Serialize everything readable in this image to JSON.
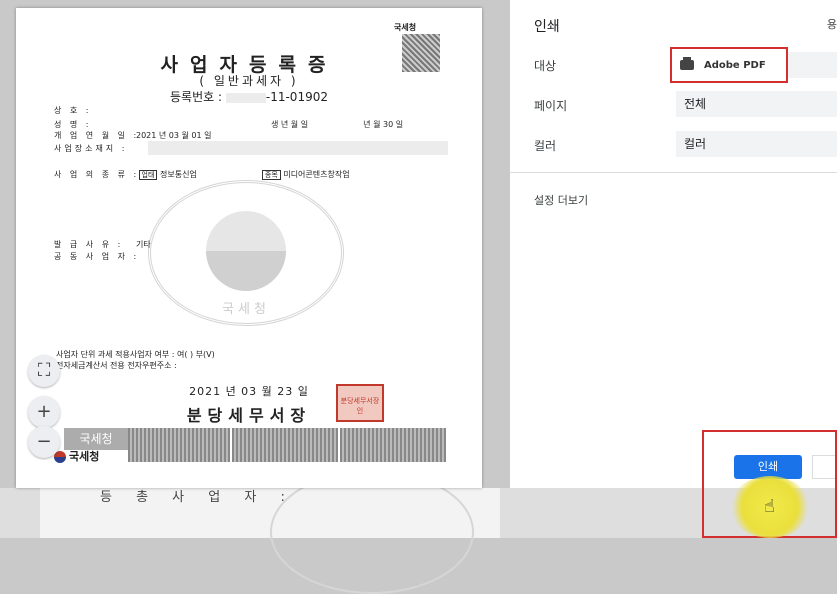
{
  "document": {
    "nts_label": "국세청",
    "title": "사업자등록증",
    "subtitle": "( 일반과세자 )",
    "reg_label": "등록번호 :",
    "reg_no": "-11-01902",
    "rows": [
      {
        "label": "상        호 :",
        "value": ""
      },
      {
        "label": "성        명 :",
        "value": ""
      },
      {
        "label": "개 업 연 월 일 :",
        "value": "2021 년 03 월 01 일"
      },
      {
        "label": "사업장소재지 :",
        "value": ""
      }
    ],
    "birth_label": "생 년 월 일",
    "birth_year": "년",
    "birth_day": "월 30 일",
    "biz_type_label": "사 업 의 종 류 :",
    "biz_tag1": "업태",
    "biz_val1": "정보통신업",
    "biz_tag2": "종목",
    "biz_val2": "미디어콘텐츠창작업",
    "reason_label": "발 급 사 유 :",
    "reason_value": "기타",
    "joint_label": "공 동 사 업 자 :",
    "seal_text": "국세청",
    "unit_tax": "사업자 단위 과세 적용사업자 여부 : 여(   ) 부(V)",
    "email_line": "전자세금계산서 전용 전자우편주소 :",
    "issue_date": "2021 년 03 월 23 일",
    "office": "분당세무서장",
    "stamp": "분당세무서장인",
    "watermark": "국세청",
    "footer_logo": "국세청"
  },
  "viewer_controls": {
    "fit": "⛶",
    "zoom_in": "+",
    "zoom_out": "−"
  },
  "panel": {
    "title": "인쇄",
    "cut_text": "용",
    "destination_label": "대상",
    "destination_value": "Adobe PDF",
    "pages_label": "페이지",
    "pages_value": "전체",
    "color_label": "컬러",
    "color_value": "컬러",
    "more_settings": "설정 더보기",
    "print_button": "인쇄"
  },
  "background": {
    "text": "등 총 사 업 자 :"
  },
  "colors": {
    "accent": "#1a73e8",
    "highlight": "#d32f2f"
  }
}
